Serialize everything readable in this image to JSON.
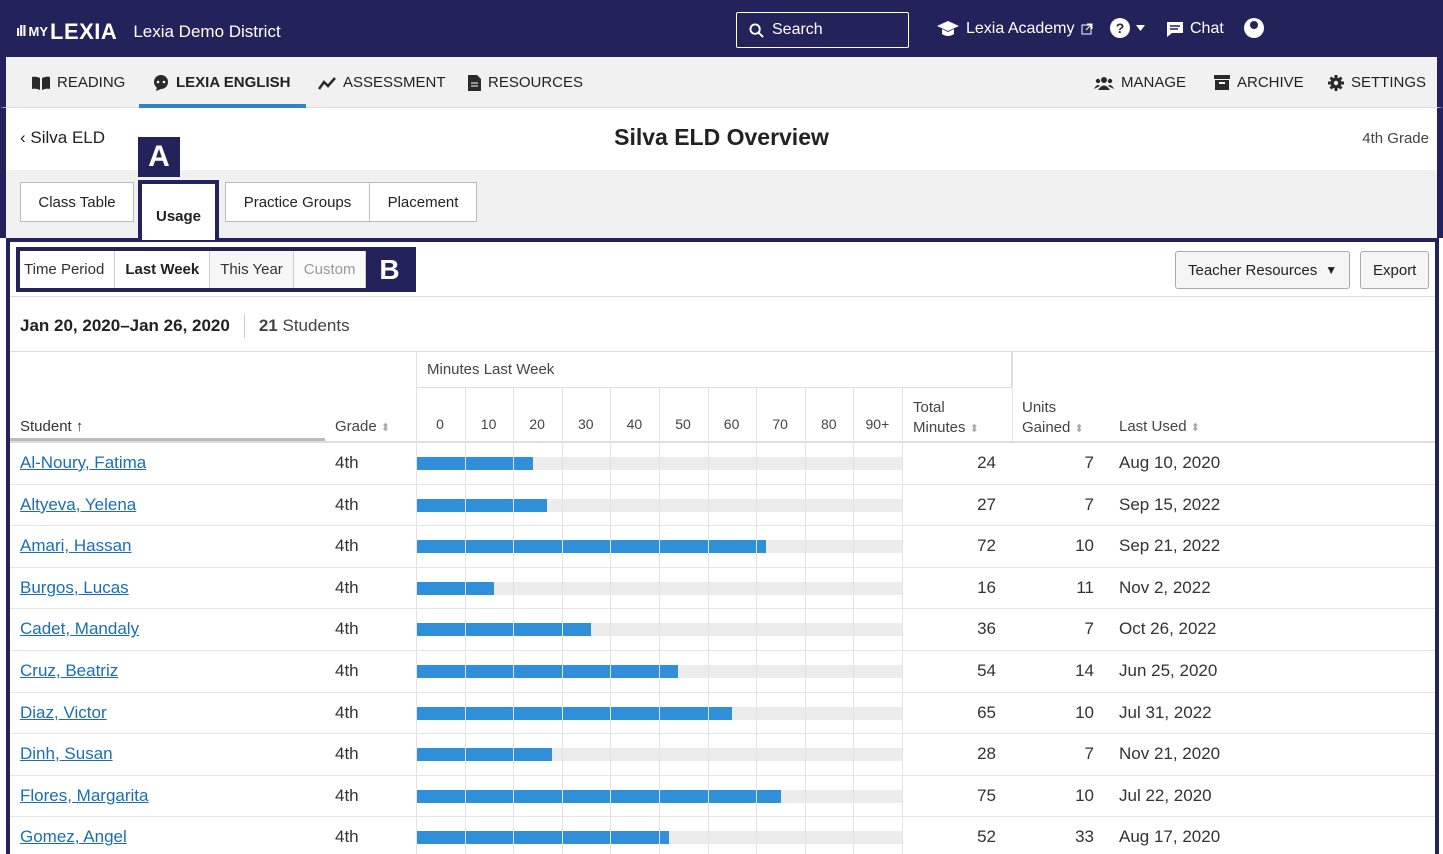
{
  "topbar": {
    "logo_bars": "ıll",
    "logo_my": "MY",
    "logo_name": "LEXIA",
    "district": "Lexia Demo District",
    "search_label": "Search",
    "academy_label": "Lexia Academy",
    "help_label": "?",
    "chat_label": "Chat"
  },
  "nav": {
    "reading": "READING",
    "lexia_english": "LEXIA ENGLISH",
    "assessment": "ASSESSMENT",
    "resources": "RESOURCES",
    "manage": "MANAGE",
    "archive": "ARCHIVE",
    "settings": "SETTINGS"
  },
  "header": {
    "back_label": "Silva ELD",
    "title": "Silva ELD Overview",
    "grade": "4th Grade"
  },
  "tabs": [
    "Class Table",
    "Usage",
    "Practice Groups",
    "Placement"
  ],
  "callouts": {
    "a": "A",
    "b": "B"
  },
  "period": {
    "label": "Time Period",
    "options": [
      "Last Week",
      "This Year",
      "Custom"
    ],
    "selected": "Last Week"
  },
  "toolbar": {
    "teacher_resources": "Teacher Resources",
    "export": "Export"
  },
  "summary": {
    "dates": "Jan 20, 2020–Jan 26, 2020",
    "count": "21",
    "count_label": "Students"
  },
  "table": {
    "col_student": "Student",
    "col_grade": "Grade",
    "col_minutes_group": "Minutes Last Week",
    "col_total_line1": "Total",
    "col_total_line2": "Minutes",
    "col_units_line1": "Units",
    "col_units_line2": "Gained",
    "col_last_used": "Last Used",
    "ticks": [
      "0",
      "10",
      "20",
      "30",
      "40",
      "50",
      "60",
      "70",
      "80",
      "90+"
    ],
    "bar_max_minutes": 100,
    "rows": [
      {
        "name": "Al-Noury, Fatima",
        "grade": "4th",
        "minutes": 24,
        "units": 7,
        "last_used": "Aug 10, 2020"
      },
      {
        "name": "Altyeva, Yelena",
        "grade": "4th",
        "minutes": 27,
        "units": 7,
        "last_used": "Sep 15, 2022"
      },
      {
        "name": "Amari, Hassan",
        "grade": "4th",
        "minutes": 72,
        "units": 10,
        "last_used": "Sep 21, 2022"
      },
      {
        "name": "Burgos, Lucas",
        "grade": "4th",
        "minutes": 16,
        "units": 11,
        "last_used": "Nov 2, 2022"
      },
      {
        "name": "Cadet, Mandaly",
        "grade": "4th",
        "minutes": 36,
        "units": 7,
        "last_used": "Oct 26, 2022"
      },
      {
        "name": "Cruz, Beatriz",
        "grade": "4th",
        "minutes": 54,
        "units": 14,
        "last_used": "Jun 25, 2020"
      },
      {
        "name": "Diaz, Victor",
        "grade": "4th",
        "minutes": 65,
        "units": 10,
        "last_used": "Jul 31, 2022"
      },
      {
        "name": "Dinh, Susan",
        "grade": "4th",
        "minutes": 28,
        "units": 7,
        "last_used": "Nov 21, 2020"
      },
      {
        "name": "Flores, Margarita",
        "grade": "4th",
        "minutes": 75,
        "units": 10,
        "last_used": "Jul 22, 2020"
      },
      {
        "name": "Gomez, Angel",
        "grade": "4th",
        "minutes": 52,
        "units": 33,
        "last_used": "Aug 17, 2020"
      }
    ]
  },
  "colors": {
    "navy": "#24225a",
    "accent": "#2a86c9",
    "bar": "#2f90d9",
    "link": "#1a6eb5"
  }
}
